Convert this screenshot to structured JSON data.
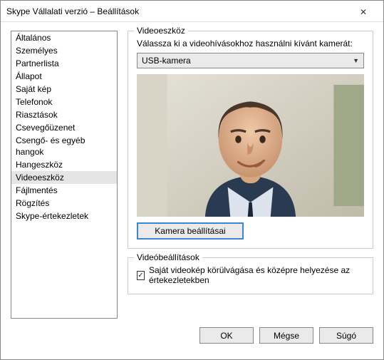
{
  "window": {
    "title": "Skype Vállalati verzió – Beállítások"
  },
  "sidebar": {
    "items": [
      {
        "label": "Általános"
      },
      {
        "label": "Személyes"
      },
      {
        "label": "Partnerlista"
      },
      {
        "label": "Állapot"
      },
      {
        "label": "Saját kép"
      },
      {
        "label": "Telefonok"
      },
      {
        "label": "Riasztások"
      },
      {
        "label": "Csevegőüzenet"
      },
      {
        "label": "Csengő- és egyéb hangok"
      },
      {
        "label": "Hangeszköz"
      },
      {
        "label": "Videoeszköz"
      },
      {
        "label": "Fájlmentés"
      },
      {
        "label": "Rögzítés"
      },
      {
        "label": "Skype-értekezletek"
      }
    ],
    "selected_index": 10
  },
  "video_device": {
    "legend": "Videoeszköz",
    "prompt": "Válassza ki a videohívásokhoz használni kívánt kamerát:",
    "selected": "USB-kamera",
    "camera_settings_button": "Kamera beállításai"
  },
  "video_settings": {
    "legend": "Videóbeállítások",
    "crop_checkbox": {
      "checked": true,
      "label": "Saját videokép körülvágása és középre helyezése az értekezletekben"
    }
  },
  "buttons": {
    "ok": "OK",
    "cancel": "Mégse",
    "help": "Súgó"
  }
}
